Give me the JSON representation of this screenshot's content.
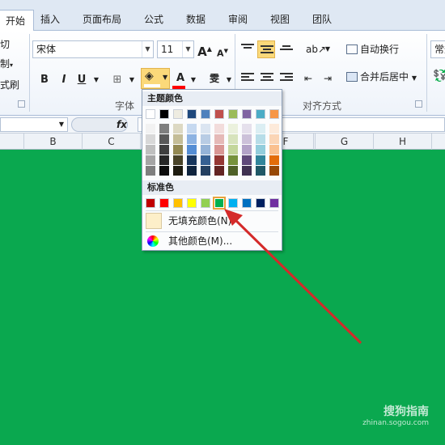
{
  "tabs": [
    "开始",
    "插入",
    "页面布局",
    "公式",
    "数据",
    "审阅",
    "视图",
    "团队"
  ],
  "clipboard": {
    "cut": "剪切",
    "copy": "复制",
    "painter": "格式刷"
  },
  "font": {
    "name": "宋体",
    "size": "11",
    "group_label": "字体"
  },
  "alignment": {
    "wrap": "自动换行",
    "merge": "合并后居中",
    "group_label": "对齐方式"
  },
  "number": {
    "format": "常规"
  },
  "formula": {
    "fx": "fx"
  },
  "columns": [
    "B",
    "C",
    "F",
    "G",
    "H"
  ],
  "popup": {
    "theme_title": "主题颜色",
    "standard_title": "标准色",
    "no_fill": "无填充颜色(N)",
    "more_colors": "其他颜色(M)...",
    "theme_row": [
      "#ffffff",
      "#000000",
      "#eeece1",
      "#1f497d",
      "#4f81bd",
      "#c0504d",
      "#9bbb59",
      "#8064a2",
      "#4bacc6",
      "#f79646"
    ],
    "theme_shades": [
      [
        "#f2f2f2",
        "#7f7f7f",
        "#ddd9c3",
        "#c6d9f0",
        "#dbe5f1",
        "#f2dcdb",
        "#ebf1dd",
        "#e5e0ec",
        "#dbeef3",
        "#fdeada"
      ],
      [
        "#d8d8d8",
        "#595959",
        "#c4bd97",
        "#8db3e2",
        "#b8cce4",
        "#e5b9b7",
        "#d7e3bc",
        "#ccc1d9",
        "#b7dde8",
        "#fbd5b5"
      ],
      [
        "#bfbfbf",
        "#3f3f3f",
        "#938953",
        "#548dd4",
        "#95b3d7",
        "#d99694",
        "#c3d69b",
        "#b2a2c7",
        "#92cddc",
        "#fac08f"
      ],
      [
        "#a5a5a5",
        "#262626",
        "#494429",
        "#17365d",
        "#366092",
        "#953734",
        "#76923c",
        "#5f497a",
        "#31859b",
        "#e36c09"
      ],
      [
        "#7f7f7f",
        "#0c0c0c",
        "#1d1b10",
        "#0f243e",
        "#244061",
        "#632423",
        "#4f6128",
        "#3f3151",
        "#205867",
        "#974806"
      ]
    ],
    "standard_colors": [
      "#c00000",
      "#ff0000",
      "#ffc000",
      "#ffff00",
      "#92d050",
      "#00b050",
      "#00b0f0",
      "#0070c0",
      "#002060",
      "#7030a0"
    ],
    "selected_standard_index": 5
  },
  "colors": {
    "sheet_fill": "#0aa84f",
    "arrow": "#d42a2a",
    "ribbon_bg": "#dfe8f3"
  },
  "watermark": {
    "brand": "搜狗指南",
    "url": "zhinan.sogou.com"
  }
}
